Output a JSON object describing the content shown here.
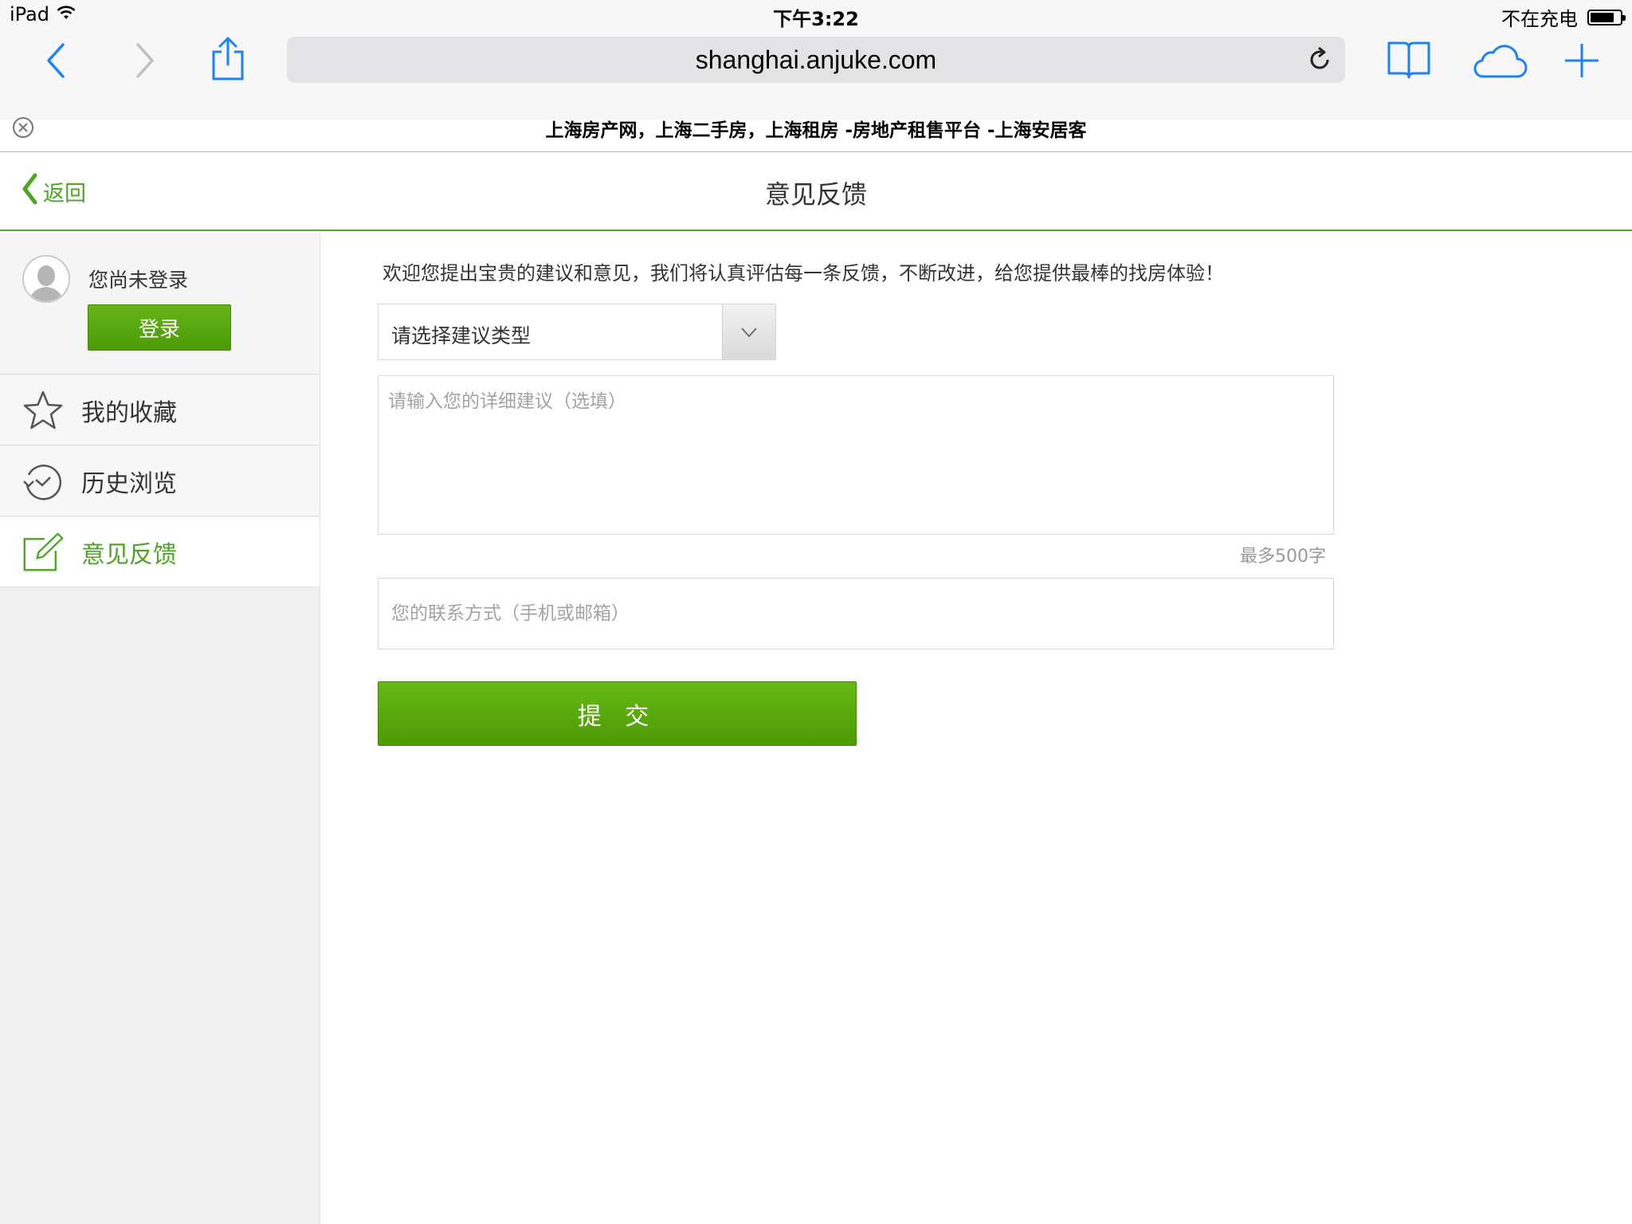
{
  "status_bar": {
    "device": "iPad",
    "time": "下午3:22",
    "charging_status": "不在充电",
    "battery_level_fraction": 0.8
  },
  "browser": {
    "url": "shanghai.anjuke.com",
    "tab_title": "上海房产网，上海二手房，上海租房 -房地产租售平台 -上海安居客",
    "icons": {
      "back": "chevron-left-icon",
      "forward": "chevron-right-icon",
      "share": "share-icon",
      "reload": "reload-icon",
      "bookmarks": "book-icon",
      "icloud_tabs": "cloud-icon",
      "new_tab": "plus-icon",
      "close_tab": "close-circle-icon"
    }
  },
  "header": {
    "back_label": "返回",
    "title": "意见反馈"
  },
  "sidebar": {
    "user": {
      "status_text": "您尚未登录",
      "login_label": "登录"
    },
    "items": [
      {
        "label": "我的收藏",
        "icon": "star-icon",
        "active": false
      },
      {
        "label": "历史浏览",
        "icon": "history-icon",
        "active": false
      },
      {
        "label": "意见反馈",
        "icon": "edit-icon",
        "active": true
      }
    ]
  },
  "form": {
    "intro": "欢迎您提出宝贵的建议和意见，我们将认真评估每一条反馈，不断改进，给您提供最棒的找房体验！",
    "type_select_value": "请选择建议类型",
    "detail_placeholder": "请输入您的详细建议（选填）",
    "char_limit_text": "最多500字",
    "contact_placeholder": "您的联系方式（手机或邮箱）",
    "submit_label": "提 交"
  },
  "colors": {
    "brand_green": "#4ba622",
    "button_green": "#5aab0e",
    "ios_blue": "#1a82fb"
  }
}
